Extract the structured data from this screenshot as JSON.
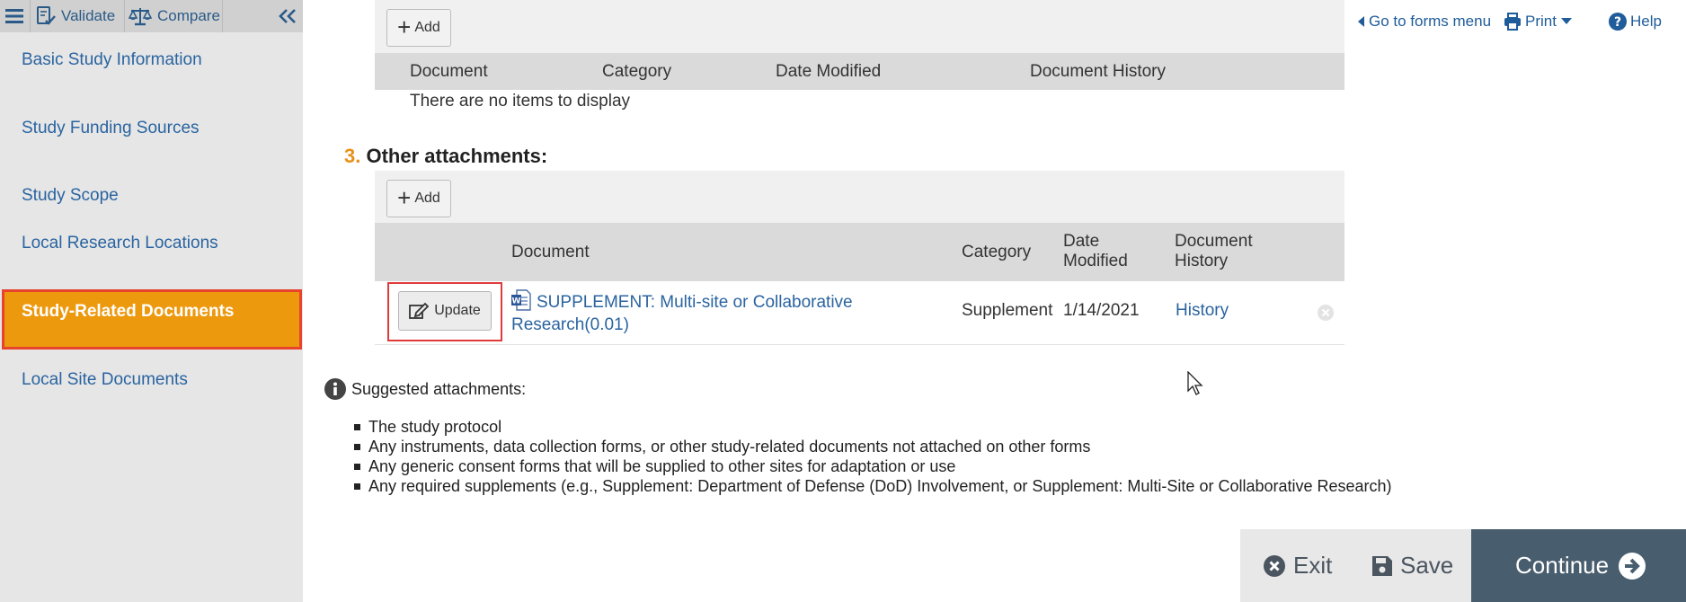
{
  "toolbar": {
    "validate_label": "Validate",
    "compare_label": "Compare"
  },
  "sidebar": {
    "items": [
      {
        "label": "Basic Study Information"
      },
      {
        "label": "Study Funding Sources"
      },
      {
        "label": "Study Scope"
      },
      {
        "label": "Local Research Locations"
      },
      {
        "label": "Study-Related Documents",
        "active": true
      },
      {
        "label": "Local Site Documents"
      }
    ]
  },
  "top_links": {
    "forms_menu": "Go to forms menu",
    "print": "Print",
    "help": "Help"
  },
  "upper_grid": {
    "add_label": "Add",
    "columns": [
      "Document",
      "Category",
      "Date Modified",
      "Document History"
    ],
    "empty_text": "There are no items to display"
  },
  "section3": {
    "number": "3.",
    "title": "Other attachments:",
    "add_label": "Add",
    "columns": [
      "Document",
      "Category",
      "Date Modified",
      "Document History"
    ],
    "rows": [
      {
        "action": "Update",
        "document": "SUPPLEMENT: Multi-site or Collaborative Research(0.01)",
        "category": "Supplement",
        "date_modified": "1/14/2021",
        "history": "History"
      }
    ]
  },
  "suggested": {
    "heading": "Suggested attachments:",
    "items": [
      "The study protocol",
      "Any instruments, data collection forms, or other study-related documents not attached on other forms",
      "Any generic consent forms that will be supplied to other sites for adaptation or use",
      "Any required supplements (e.g., Supplement: Department of Defense (DoD) Involvement, or Supplement: Multi-Site or Collaborative Research)"
    ]
  },
  "footer": {
    "exit_label": "Exit",
    "save_label": "Save",
    "continue_label": "Continue"
  },
  "colors": {
    "accent_orange": "#ec990e",
    "highlight_red": "#e03a3a",
    "link_blue": "#2a64a0",
    "footer_dark": "#485d6e"
  }
}
